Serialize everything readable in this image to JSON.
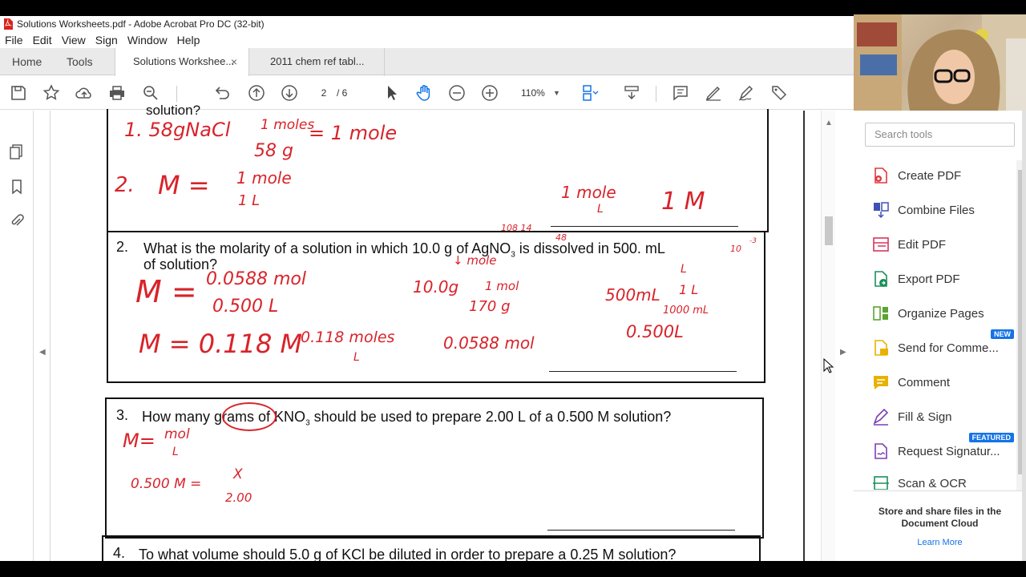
{
  "window": {
    "title": "Solutions Worksheets.pdf - Adobe Acrobat Pro DC (32-bit)"
  },
  "menu": [
    "File",
    "Edit",
    "View",
    "Sign",
    "Window",
    "Help"
  ],
  "tabs": {
    "home": "Home",
    "tools": "Tools",
    "doc1": "Solutions Workshee...",
    "doc2": "2011 chem ref tabl...",
    "close": "×"
  },
  "toolbar": {
    "page_current": "2",
    "page_total": "/  6",
    "zoom": "110%",
    "zoom_caret": "▼"
  },
  "document": {
    "q1_fragment": "solution?",
    "q2": {
      "number": "2.",
      "text_a": "What is the molarity of a solution in which 10.0 g of AgNO",
      "sub": "3",
      "text_b": " is dissolved in 500. mL",
      "text_c": "of solution?"
    },
    "q3": {
      "number": "3.",
      "text_a": "How many grams of KNO",
      "sub": "3",
      "text_b": " should be used to prepare 2.00 L of a 0.500 M solution?"
    },
    "q4": {
      "number": "4.",
      "text": "To what volume should 5.0 g of KCl be diluted in order to prepare a 0.25 M solution?"
    },
    "handwriting": {
      "h1": "1.  58gNaCl",
      "h1b": "1 moles",
      "h1c": "58 g",
      "h1d": "=  1 mole",
      "h2": "2.",
      "h2b": "M =",
      "h2c": "1 mole",
      "h2d": "1 L",
      "h3": "1 mole",
      "h3b": "L",
      "h3c": "1 M",
      "h4": "108  14",
      "h4b": "48",
      "h4c": "↓ mole",
      "h4d": "10",
      "h4e": "-3",
      "h4f": "L",
      "h5": "M =",
      "h5b": "0.0588 mol",
      "h5c": "0.500 L",
      "h6": "10.0g",
      "h6b": "1  mol",
      "h6c": "170 g",
      "h7": "500mL",
      "h7b": "1 L",
      "h7c": "1000 mL",
      "h8": "M = 0.118 M",
      "h9": "0.118 moles",
      "h9b": "L",
      "h10": "0.0588 mol",
      "h11": "0.500L",
      "h12": "M=",
      "h12b": "mol",
      "h12c": "L",
      "h13": "0.500 M =",
      "h13b": "X",
      "h13c": "2.00"
    }
  },
  "right_panel": {
    "search_placeholder": "Search tools",
    "tools": [
      {
        "label": "Create PDF",
        "color": "#e0383e"
      },
      {
        "label": "Combine Files",
        "color": "#3f51b5"
      },
      {
        "label": "Edit PDF",
        "color": "#d9365e"
      },
      {
        "label": "Export PDF",
        "color": "#1b8f5a"
      },
      {
        "label": "Organize Pages",
        "color": "#5aa431"
      },
      {
        "label": "Send for Comme...",
        "color": "#e8b200",
        "badge": "NEW"
      },
      {
        "label": "Comment",
        "color": "#e8b200"
      },
      {
        "label": "Fill & Sign",
        "color": "#7b3fb6"
      },
      {
        "label": "Request Signatur...",
        "color": "#7b3fb6",
        "badge": "FEATURED"
      },
      {
        "label": "Scan & OCR",
        "color": "#1b8f5a"
      }
    ],
    "cloud_text": "Store and share files in the Document Cloud",
    "learn_more": "Learn More"
  }
}
